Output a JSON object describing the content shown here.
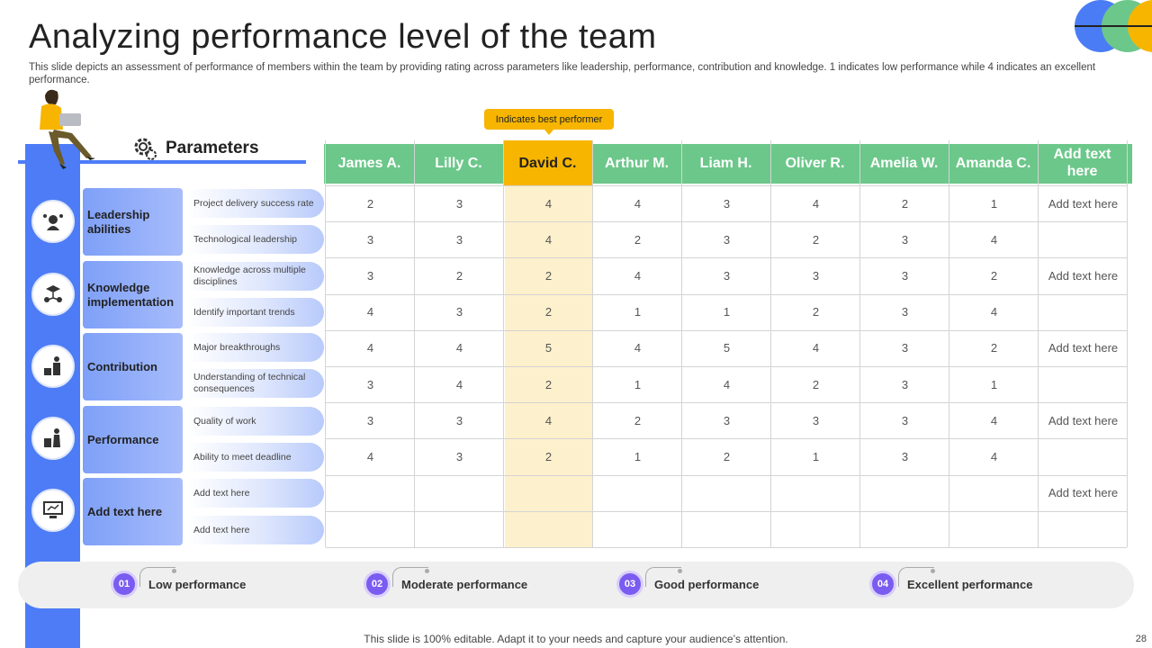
{
  "title": "Analyzing performance level of the team",
  "subtitle": "This slide depicts an assessment of performance of members within the team by providing rating across parameters like leadership, performance, contribution and knowledge. 1 indicates low performance while 4 indicates an excellent performance.",
  "parameters_label": "Parameters",
  "best_performer_tag": "Indicates best performer",
  "colors": {
    "blue": "#4d7cf6",
    "green": "#6cc78a",
    "yellow": "#f7b500",
    "purple": "#7b5cf0"
  },
  "columns": [
    "James A.",
    "Lilly C.",
    "David C.",
    "Arthur M.",
    "Liam H.",
    "Oliver R.",
    "Amelia W.",
    "Amanda C.",
    "Add text here"
  ],
  "categories": [
    {
      "label": "Leadership abilities",
      "icon": "leadership-icon",
      "subs": [
        "Project delivery success rate",
        "Technological leadership"
      ]
    },
    {
      "label": "Knowledge implementation",
      "icon": "knowledge-icon",
      "subs": [
        "Knowledge across multiple  disciplines",
        "Identify important trends"
      ]
    },
    {
      "label": "Contribution",
      "icon": "contribution-icon",
      "subs": [
        "Major breakthroughs",
        "Understanding of technical consequences"
      ]
    },
    {
      "label": "Performance",
      "icon": "performance-icon",
      "subs": [
        "Quality of work",
        "Ability to meet deadline"
      ]
    },
    {
      "label": "Add text here",
      "icon": "presentation-icon",
      "subs": [
        "Add text here",
        "Add text here"
      ]
    }
  ],
  "rows": [
    [
      "2",
      "3",
      "4",
      "4",
      "3",
      "4",
      "2",
      "1",
      "Add text here"
    ],
    [
      "3",
      "3",
      "4",
      "2",
      "3",
      "2",
      "3",
      "4",
      ""
    ],
    [
      "3",
      "2",
      "2",
      "4",
      "3",
      "3",
      "3",
      "2",
      "Add text here"
    ],
    [
      "4",
      "3",
      "2",
      "1",
      "1",
      "2",
      "3",
      "4",
      ""
    ],
    [
      "4",
      "4",
      "5",
      "4",
      "5",
      "4",
      "3",
      "2",
      "Add text here"
    ],
    [
      "3",
      "4",
      "2",
      "1",
      "4",
      "2",
      "3",
      "1",
      ""
    ],
    [
      "3",
      "3",
      "4",
      "2",
      "3",
      "3",
      "3",
      "4",
      "Add text here"
    ],
    [
      "4",
      "3",
      "2",
      "1",
      "2",
      "1",
      "3",
      "4",
      ""
    ],
    [
      "",
      "",
      "",
      "",
      "",
      "",
      "",
      "",
      "Add text here"
    ],
    [
      "",
      "",
      "",
      "",
      "",
      "",
      "",
      "",
      ""
    ]
  ],
  "legend": [
    {
      "num": "01",
      "label": "Low performance"
    },
    {
      "num": "02",
      "label": "Moderate performance"
    },
    {
      "num": "03",
      "label": "Good performance"
    },
    {
      "num": "04",
      "label": "Excellent performance"
    }
  ],
  "footer": "This slide is 100% editable. Adapt it to your needs and capture your audience’s attention.",
  "page_number": "28"
}
